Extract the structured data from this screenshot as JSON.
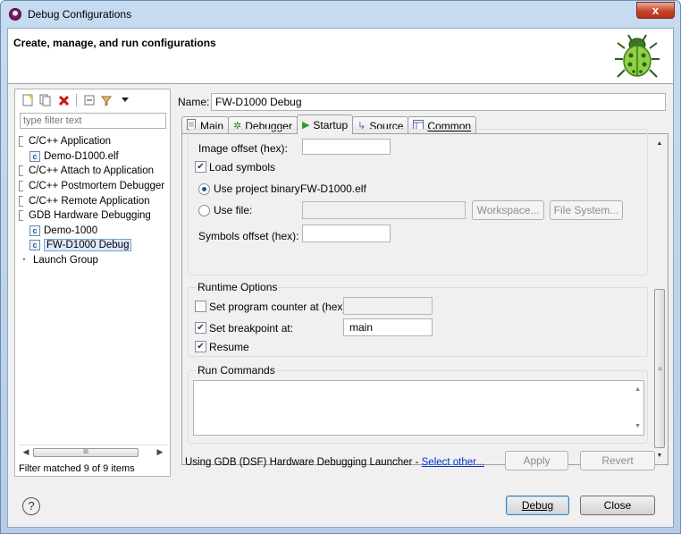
{
  "window": {
    "title": "Debug Configurations",
    "close_label": "x"
  },
  "header": {
    "title": "Create, manage, and run configurations"
  },
  "left": {
    "filter_placeholder": "type filter text",
    "tree": [
      {
        "label": "C/C++ Application",
        "type": "group"
      },
      {
        "label": "Demo-D1000.elf",
        "type": "child"
      },
      {
        "label": "C/C++ Attach to Application",
        "type": "group"
      },
      {
        "label": "C/C++ Postmortem Debugger",
        "type": "group"
      },
      {
        "label": "C/C++ Remote Application",
        "type": "group"
      },
      {
        "label": "GDB Hardware Debugging",
        "type": "group"
      },
      {
        "label": "Demo-1000",
        "type": "child"
      },
      {
        "label": "FW-D1000 Debug",
        "type": "child",
        "selected": true
      },
      {
        "label": "Launch Group",
        "type": "launch"
      }
    ],
    "scroll_thumb": "III",
    "status": "Filter matched 9 of 9 items"
  },
  "name": {
    "label": "Name:",
    "value": "FW-D1000 Debug"
  },
  "tabs": [
    {
      "label": "Main",
      "icon": "main-tab-icon"
    },
    {
      "label": "Debugger",
      "icon": "debugger-tab-icon"
    },
    {
      "label": "Startup",
      "icon": "startup-tab-icon",
      "active": true
    },
    {
      "label": "Source",
      "icon": "source-tab-icon"
    },
    {
      "label": "Common",
      "icon": "common-tab-icon"
    }
  ],
  "startup": {
    "image_offset_label": "Image offset (hex):",
    "image_offset_value": "",
    "load_symbols_label": "Load symbols",
    "load_symbols_checked": true,
    "use_project_binary_label": "Use project binary:",
    "project_binary_value": "FW-D1000.elf",
    "use_file_label": "Use file:",
    "use_file_value": "",
    "workspace_button": "Workspace...",
    "filesystem_button": "File System...",
    "symbols_offset_label": "Symbols offset (hex):",
    "symbols_offset_value": ""
  },
  "runtime": {
    "title": "Runtime Options",
    "set_pc_label": "Set program counter at (hex):",
    "set_pc_checked": false,
    "set_pc_value": "",
    "set_bp_label": "Set breakpoint at:",
    "set_bp_checked": true,
    "set_bp_value": "main",
    "resume_label": "Resume",
    "resume_checked": true
  },
  "run_commands": {
    "title": "Run Commands",
    "value": ""
  },
  "launcher": {
    "text": "Using GDB (DSF) Hardware Debugging Launcher - ",
    "link": "Select other..."
  },
  "buttons": {
    "apply": "Apply",
    "revert": "Revert",
    "debug": "Debug",
    "close": "Close",
    "help": "?"
  },
  "colors": {
    "accent": "#3c7fb1",
    "link": "#0033cc",
    "selection": "#dbe8f8"
  }
}
